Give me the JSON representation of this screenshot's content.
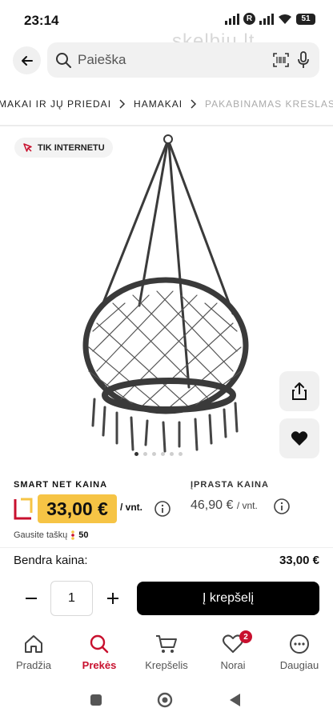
{
  "status_bar": {
    "time": "23:14",
    "network_badge": "R",
    "battery": "51"
  },
  "watermark": "skelbiu.lt",
  "search": {
    "placeholder": "Paieška"
  },
  "breadcrumb": [
    "MAKAI IR JŲ PRIEDAI",
    "HAMAKAI",
    "PAKABINAMAS KRESLAS M..."
  ],
  "product": {
    "tag": "TIK INTERNETU",
    "image_alt": "Pakabinamas kreslas",
    "gallery_count": 6,
    "gallery_active": 1
  },
  "pricing": {
    "smart_label": "SMART NET KAINA",
    "smart_price": "33,00 €",
    "smart_unit": "/ vnt.",
    "regular_label": "ĮPRASTA KAINA",
    "regular_price": "46,90 €",
    "regular_unit": "/ vnt.",
    "points_label": "Gausite taškų",
    "points_value": "50"
  },
  "total": {
    "label": "Bendra kaina:",
    "value": "33,00 €"
  },
  "quantity": {
    "value": "1"
  },
  "cart_button": "Į krepšelį",
  "bottom_nav": [
    {
      "label": "Pradžia",
      "icon": "home-icon"
    },
    {
      "label": "Prekės",
      "icon": "search-icon",
      "active": true
    },
    {
      "label": "Krepšelis",
      "icon": "cart-icon"
    },
    {
      "label": "Norai",
      "icon": "heart-icon",
      "badge": "2"
    },
    {
      "label": "Daugiau",
      "icon": "more-icon"
    }
  ],
  "colors": {
    "accent": "#c8102e",
    "price_highlight": "#f6c445",
    "button": "#000000"
  }
}
